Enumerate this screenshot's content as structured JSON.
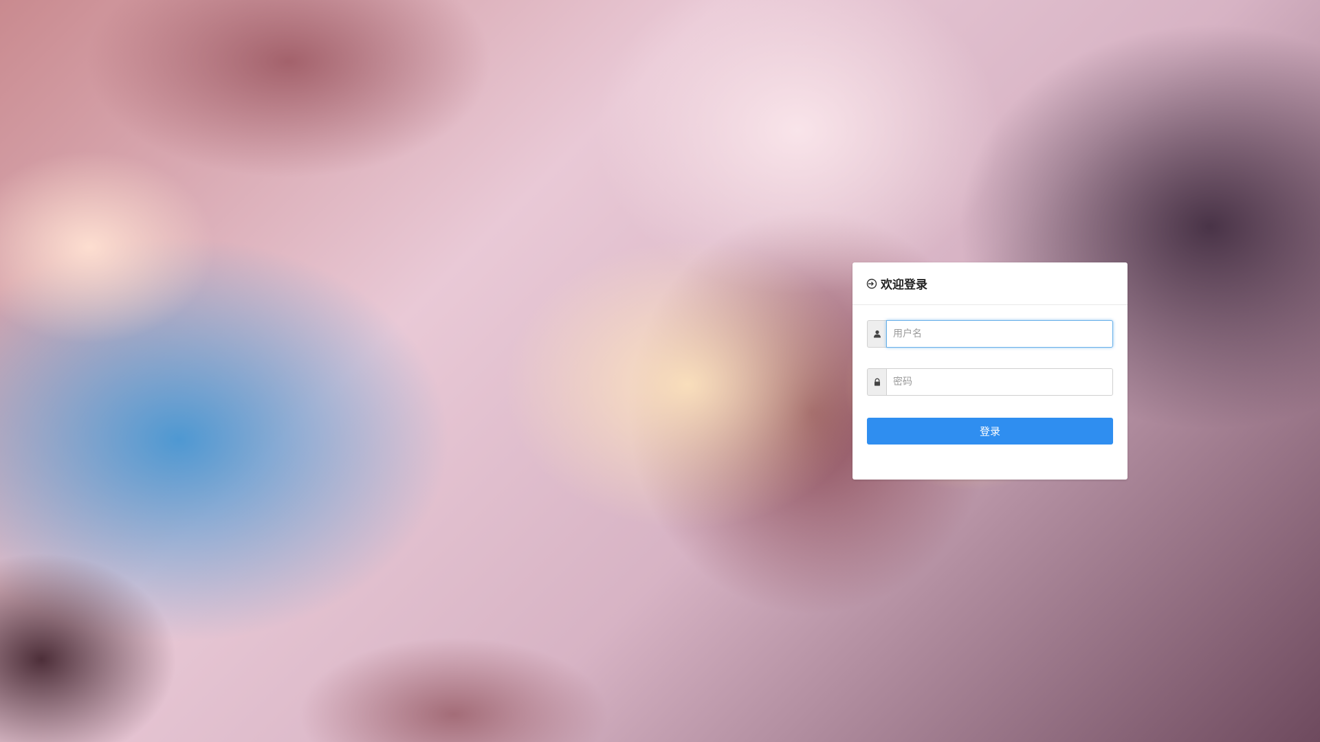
{
  "login": {
    "title": "欢迎登录",
    "title_icon": "login-arrow-icon",
    "username": {
      "placeholder": "用户名",
      "value": "",
      "icon": "user-icon"
    },
    "password": {
      "placeholder": "密码",
      "value": "",
      "icon": "lock-icon"
    },
    "submit_label": "登录"
  },
  "colors": {
    "button": "#2f8ef0",
    "focus_border": "#66afe9",
    "card": "#ffffff"
  }
}
